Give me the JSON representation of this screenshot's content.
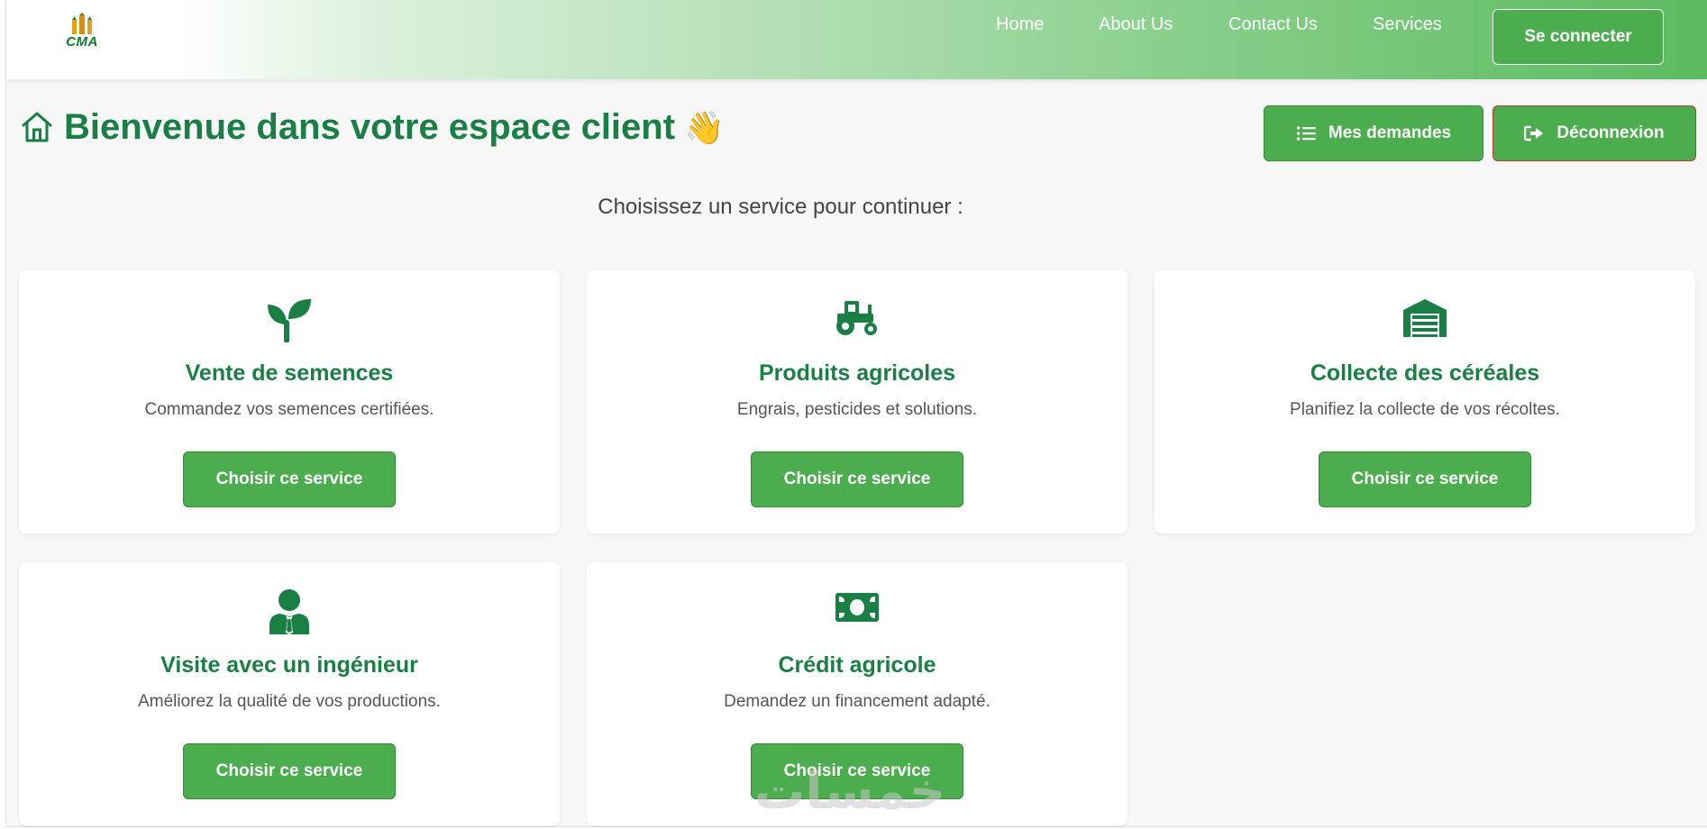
{
  "navbar": {
    "logo_text": "CMA",
    "links": [
      "Home",
      "About Us",
      "Contact Us",
      "Services"
    ],
    "login_label": "Se connecter"
  },
  "header": {
    "title": "Bienvenue dans votre espace client",
    "wave_emoji": "👋",
    "demandes_label": "Mes demandes",
    "logout_label": "Déconnexion"
  },
  "subtitle": "Choisissez un service pour continuer :",
  "services": [
    {
      "icon": "seedling-icon",
      "title": "Vente de semences",
      "desc": "Commandez vos semences certifiées.",
      "button": "Choisir ce service"
    },
    {
      "icon": "tractor-icon",
      "title": "Produits agricoles",
      "desc": "Engrais, pesticides et solutions.",
      "button": "Choisir ce service"
    },
    {
      "icon": "warehouse-icon",
      "title": "Collecte des céréales",
      "desc": "Planifiez la collecte de vos récoltes.",
      "button": "Choisir ce service"
    },
    {
      "icon": "user-tie-icon",
      "title": "Visite avec un ingénieur",
      "desc": "Améliorez la qualité de vos productions.",
      "button": "Choisir ce service"
    },
    {
      "icon": "money-bill-icon",
      "title": "Crédit agricole",
      "desc": "Demandez un financement adapté.",
      "button": "Choisir ce service"
    }
  ],
  "watermark": "خمسات",
  "colors": {
    "brand_green": "#4cad4f",
    "title_green": "#1a7f45",
    "logout_border": "#c0392b"
  }
}
